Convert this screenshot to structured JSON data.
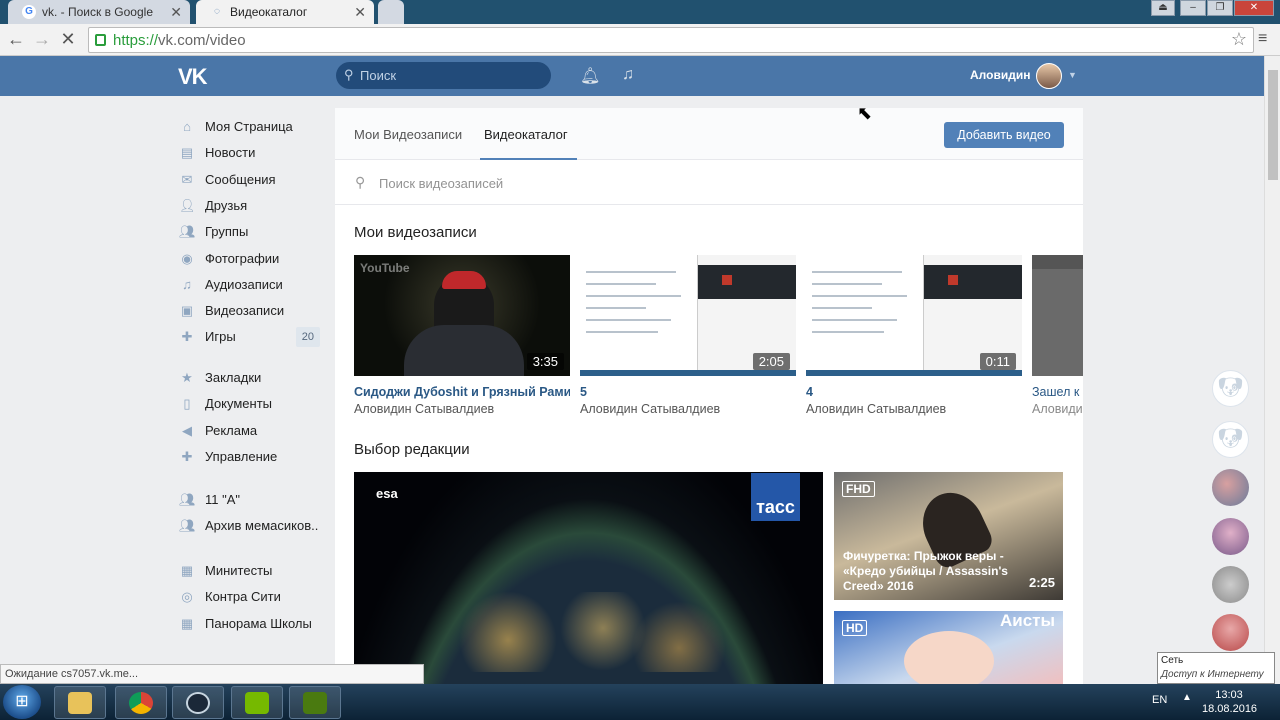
{
  "browser": {
    "tabs": [
      {
        "title": "vk. - Поиск в Google",
        "active": false
      },
      {
        "title": "Видеокаталог",
        "active": true
      }
    ],
    "url_scheme": "https://",
    "url_rest": "vk.com/video",
    "back_icon": "arrow-left",
    "forward_icon": "arrow-right",
    "loading_icon": "stop-x",
    "status_text": "Ожидание cs7057.vk.me..."
  },
  "vk_header": {
    "logo": "VK",
    "search_placeholder": "Поиск",
    "user_name": "Аловидин"
  },
  "sidebar": {
    "group1": [
      {
        "label": "Моя Страница",
        "icon": "home-icon"
      },
      {
        "label": "Новости",
        "icon": "news-icon"
      },
      {
        "label": "Сообщения",
        "icon": "message-icon"
      },
      {
        "label": "Друзья",
        "icon": "friends-icon"
      },
      {
        "label": "Группы",
        "icon": "groups-icon"
      },
      {
        "label": "Фотографии",
        "icon": "camera-icon"
      },
      {
        "label": "Аудиозаписи",
        "icon": "music-icon"
      },
      {
        "label": "Видеозаписи",
        "icon": "video-icon"
      },
      {
        "label": "Игры",
        "icon": "gamepad-icon",
        "badge": "20"
      }
    ],
    "group2": [
      {
        "label": "Закладки",
        "icon": "star-icon"
      },
      {
        "label": "Документы",
        "icon": "document-icon"
      },
      {
        "label": "Реклама",
        "icon": "megaphone-icon"
      },
      {
        "label": "Управление",
        "icon": "gamepad-icon"
      }
    ],
    "group3": [
      {
        "label": "11 \"А\"",
        "icon": "community-icon"
      },
      {
        "label": "Архив мемасиков..",
        "icon": "community-icon"
      }
    ],
    "group4": [
      {
        "label": "Минитесты",
        "icon": "app-icon"
      },
      {
        "label": "Контра Сити",
        "icon": "target-icon"
      },
      {
        "label": "Панорама Школы",
        "icon": "app-icon"
      }
    ]
  },
  "video_page": {
    "tab_my": "Мои Видеозаписи",
    "tab_catalog": "Видеокаталог",
    "add_button": "Добавить видео",
    "search_placeholder": "Поиск видеозаписей",
    "my_videos_heading": "Мои видеозаписи",
    "my_videos": [
      {
        "title": "Сидоджи Дубоshit и Грязный Рамир...",
        "author": "Аловидин Сатывалдиев",
        "duration": "3:35",
        "watermark": "YouTube"
      },
      {
        "title": "5",
        "author": "Аловидин Сатывалдиев",
        "duration": "2:05"
      },
      {
        "title": "4",
        "author": "Аловидин Сатывалдиев",
        "duration": "0:11"
      },
      {
        "title": "Зашел к п",
        "author": "Аловидин",
        "duration": ""
      }
    ],
    "editors_heading": "Выбор редакции",
    "featured": {
      "brand_left": "esa",
      "brand_right": "тасс"
    },
    "side_videos": [
      {
        "badge": "FHD",
        "title": "Фичуретка: Прыжок веры - «Кредо убийцы / Assassin's Creed» 2016",
        "duration": "2:25",
        "overlay_name": ""
      },
      {
        "badge": "HD",
        "title": "",
        "duration": "",
        "overlay_name": "Аисты"
      }
    ]
  },
  "notification": {
    "title": "Сеть",
    "body": "Доступ к Интернету"
  },
  "taskbar": {
    "lang": "EN",
    "time": "13:03",
    "date": "18.08.2016",
    "apps": [
      "explorer",
      "chrome",
      "steam",
      "nvidia",
      "nvidia-experience"
    ]
  },
  "colors": {
    "vk_blue": "#4a76a8",
    "link": "#2a5885",
    "button": "#5181b8"
  }
}
